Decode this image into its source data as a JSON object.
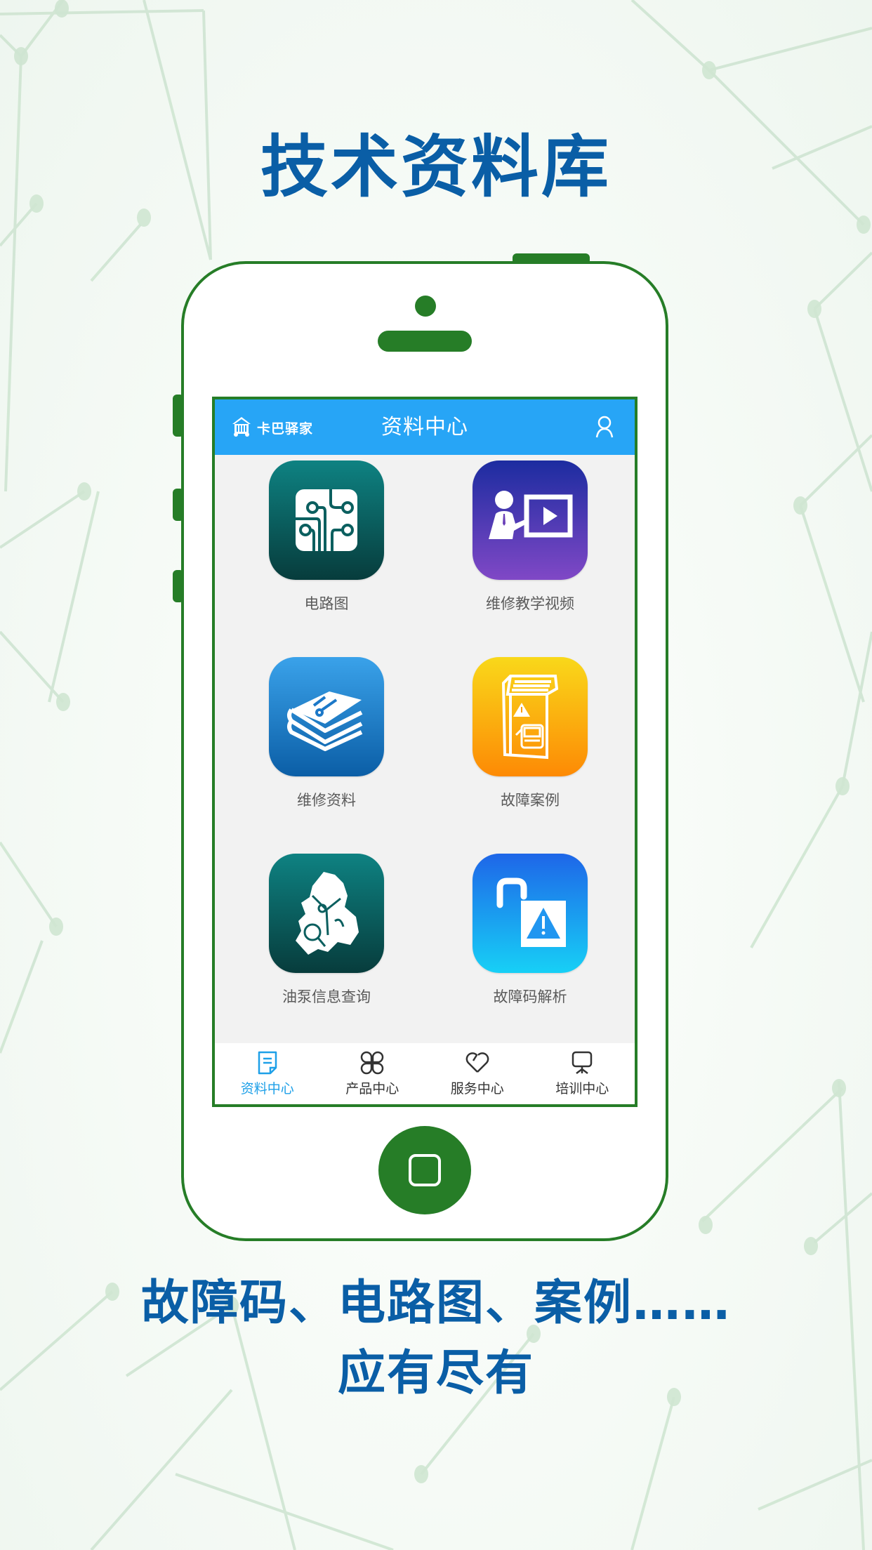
{
  "headline_top": "技术资料库",
  "headline_bottom": {
    "line1": "故障码、电路图、案例……",
    "line2": "应有尽有"
  },
  "app": {
    "brand_name": "卡巴驿家",
    "title": "资料中心",
    "accent_color": "#27a5f6",
    "frame_color": "#267d27",
    "headline_color": "#0a5ea6"
  },
  "tiles": [
    {
      "label": "电路图",
      "icon": "circuit-board-icon"
    },
    {
      "label": "维修教学视频",
      "icon": "video-teaching-icon"
    },
    {
      "label": "维修资料",
      "icon": "repair-books-icon"
    },
    {
      "label": "故障案例",
      "icon": "fault-case-book-icon"
    },
    {
      "label": "油泵信息查询",
      "icon": "oil-pump-search-icon"
    },
    {
      "label": "故障码解析",
      "icon": "unlock-warning-icon"
    }
  ],
  "tabs": [
    {
      "label": "资料中心",
      "icon": "document-icon",
      "active": true
    },
    {
      "label": "产品中心",
      "icon": "grid-icon",
      "active": false
    },
    {
      "label": "服务中心",
      "icon": "heart-icon",
      "active": false
    },
    {
      "label": "培训中心",
      "icon": "presentation-board-icon",
      "active": false
    }
  ]
}
